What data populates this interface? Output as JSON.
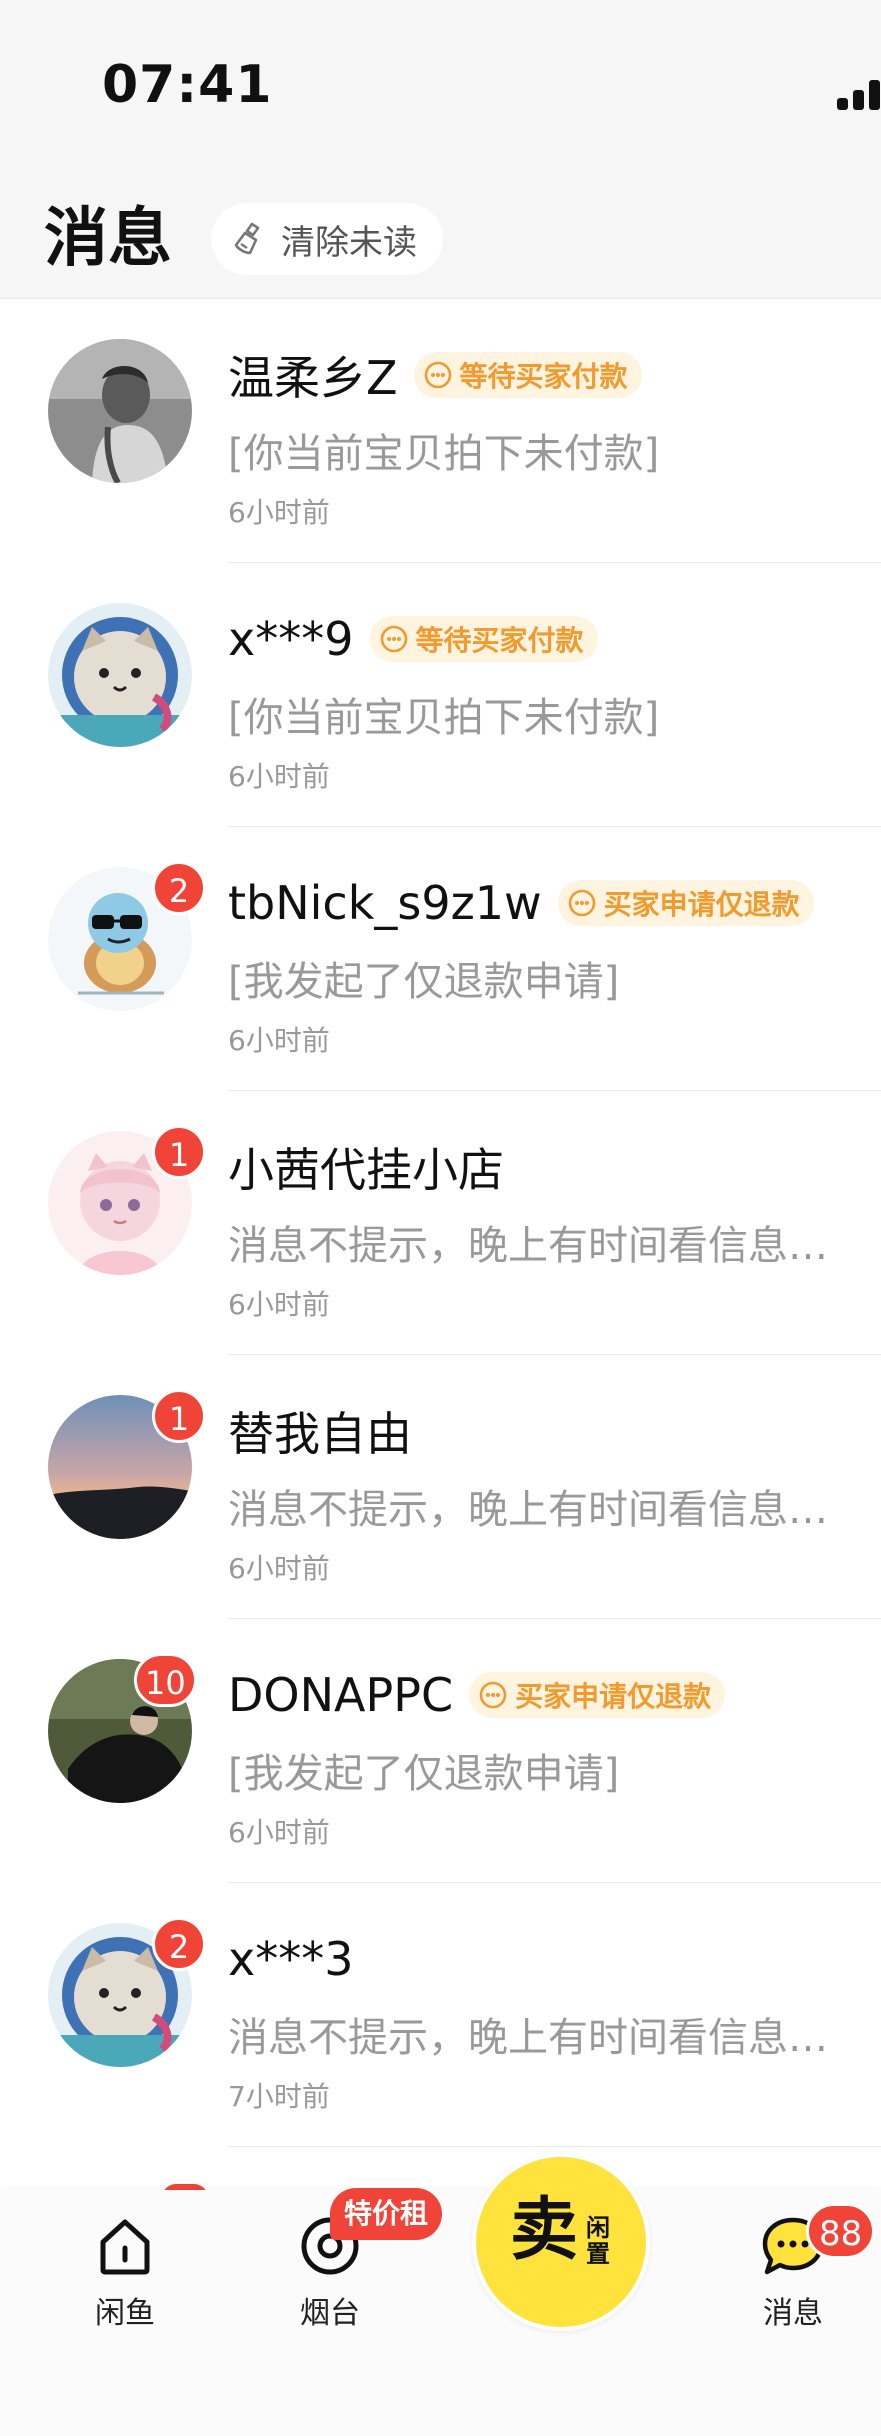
{
  "status_bar": {
    "time": "07:41"
  },
  "header": {
    "title": "消息",
    "clear_label": "清除未读"
  },
  "conversations": [
    {
      "name": "温柔乡Z",
      "tag": "等待买家付款",
      "preview": "[你当前宝贝拍下未付款]",
      "time": "6小时前",
      "unread": ""
    },
    {
      "name": "x***9",
      "tag": "等待买家付款",
      "preview": "[你当前宝贝拍下未付款]",
      "time": "6小时前",
      "unread": ""
    },
    {
      "name": "tbNick_s9z1w",
      "tag": "买家申请仅退款",
      "preview": "[我发起了仅退款申请]",
      "time": "6小时前",
      "unread": "2"
    },
    {
      "name": "小茜代挂小店",
      "tag": "",
      "preview": "消息不提示，晚上有时间看信息…",
      "time": "6小时前",
      "unread": "1"
    },
    {
      "name": "替我自由",
      "tag": "",
      "preview": "消息不提示，晚上有时间看信息…",
      "time": "6小时前",
      "unread": "1"
    },
    {
      "name": "DONAPPC",
      "tag": "买家申请仅退款",
      "preview": "[我发起了仅退款申请]",
      "time": "6小时前",
      "unread": "10"
    },
    {
      "name": "x***3",
      "tag": "",
      "preview": "消息不提示，晚上有时间看信息…",
      "time": "7小时前",
      "unread": "2"
    }
  ],
  "tabbar": {
    "home_label": "闲鱼",
    "yantai_label": "烟台",
    "promo": "特价租",
    "sell_main": "卖",
    "sell_sub": "闲置",
    "messages_label": "消息",
    "messages_count": "88"
  },
  "colors": {
    "accent": "#ffe33c",
    "badge": "#f04438",
    "tag_text": "#f29a2e",
    "tag_bg": "#fff4e0"
  }
}
